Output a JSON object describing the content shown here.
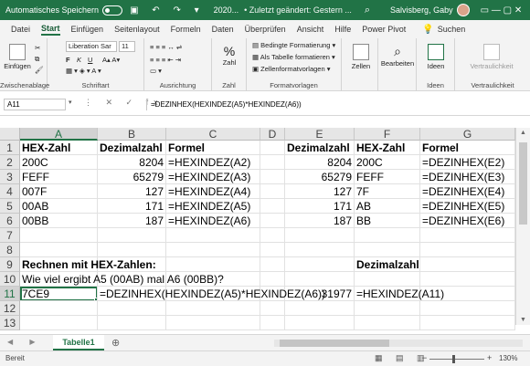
{
  "titlebar": {
    "autosave": "Automatisches Speichern",
    "quick_access": "▣ ↶ ↷ ▾",
    "filename": "2020...",
    "saved_status": "• Zuletzt geändert: Gestern ...",
    "user": "Salvisberg, Gaby",
    "window_buttons": "▭ — ▢ ✕",
    "colors": {
      "bar": "#217346"
    }
  },
  "tabs": [
    "Datei",
    "Start",
    "Einfügen",
    "Seitenlayout",
    "Formeln",
    "Daten",
    "Überprüfen",
    "Ansicht",
    "Hilfe",
    "Power Pivot",
    "Suchen"
  ],
  "active_tab": "Start",
  "ribbon": {
    "clipboard": {
      "paste": "Einfügen",
      "label": "Zwischenablage"
    },
    "font": {
      "name": "Liberation Sar",
      "size": "11",
      "bold": "F",
      "italic": "K",
      "underline": "U",
      "label": "Schriftart"
    },
    "alignment": {
      "label": "Ausrichtung"
    },
    "number": {
      "format": "%",
      "label": "Zahl",
      "sublabel": "Zahl"
    },
    "styles": {
      "cond": "Bedingte Formatierung",
      "table": "Als Tabelle formatieren",
      "cellstyles": "Zellenformatvorlagen",
      "label": "Formatvorlagen"
    },
    "cells": {
      "label": "Zellen"
    },
    "editing": {
      "label": "Bearbeiten"
    },
    "ideas": {
      "label": "Ideen",
      "button": "Ideen"
    },
    "sensitivity": {
      "label": "Vertraulichkeit",
      "button": "Vertraulichkeit"
    }
  },
  "formula_bar": {
    "namebox": "A11",
    "icons": "⋮ ✕ ✓ fx",
    "formula": "=DEZINHEX(HEXINDEZ(A5)*HEXINDEZ(A6))"
  },
  "columns": [
    "A",
    "B",
    "C",
    "D",
    "E",
    "F",
    "G"
  ],
  "rows": [
    "1",
    "2",
    "3",
    "4",
    "5",
    "6",
    "7",
    "8",
    "9",
    "10",
    "11",
    "12",
    "13"
  ],
  "cells": {
    "A1": "HEX-Zahl",
    "B1": "Dezimalzahl",
    "C1": "Formel",
    "E1": "Dezimalzahl",
    "F1": "HEX-Zahl",
    "G1": "Formel",
    "A2": "200C",
    "B2": "8204",
    "C2": "=HEXINDEZ(A2)",
    "E2": "8204",
    "F2": "200C",
    "G2": "=DEZINHEX(E2)",
    "A3": "FEFF",
    "B3": "65279",
    "C3": "=HEXINDEZ(A3)",
    "E3": "65279",
    "F3": "FEFF",
    "G3": "=DEZINHEX(E3)",
    "A4": "007F",
    "B4": "127",
    "C4": "=HEXINDEZ(A4)",
    "E4": "127",
    "F4": "7F",
    "G4": "=DEZINHEX(E4)",
    "A5": "00AB",
    "B5": "171",
    "C5": "=HEXINDEZ(A5)",
    "E5": "171",
    "F5": "AB",
    "G5": "=DEZINHEX(E5)",
    "A6": "00BB",
    "B6": "187",
    "C6": "=HEXINDEZ(A6)",
    "E6": "187",
    "F6": "BB",
    "G6": "=DEZINHEX(E6)",
    "A9": "Rechnen mit HEX-Zahlen:",
    "F9": "Dezimalzahl",
    "A10": "Wie viel ergibt A5 (00AB) mal A6 (00BB)?",
    "A11": "7CE9",
    "B11": "=DEZINHEX(HEXINDEZ(A5)*HEXINDEZ(A6))",
    "E11": "31977",
    "F11": "=HEXINDEZ(A11)"
  },
  "sheet_tab": "Tabelle1",
  "status": {
    "text": "Bereit",
    "view_icons": "▦ ▤ ▥",
    "zoom": "130%"
  }
}
